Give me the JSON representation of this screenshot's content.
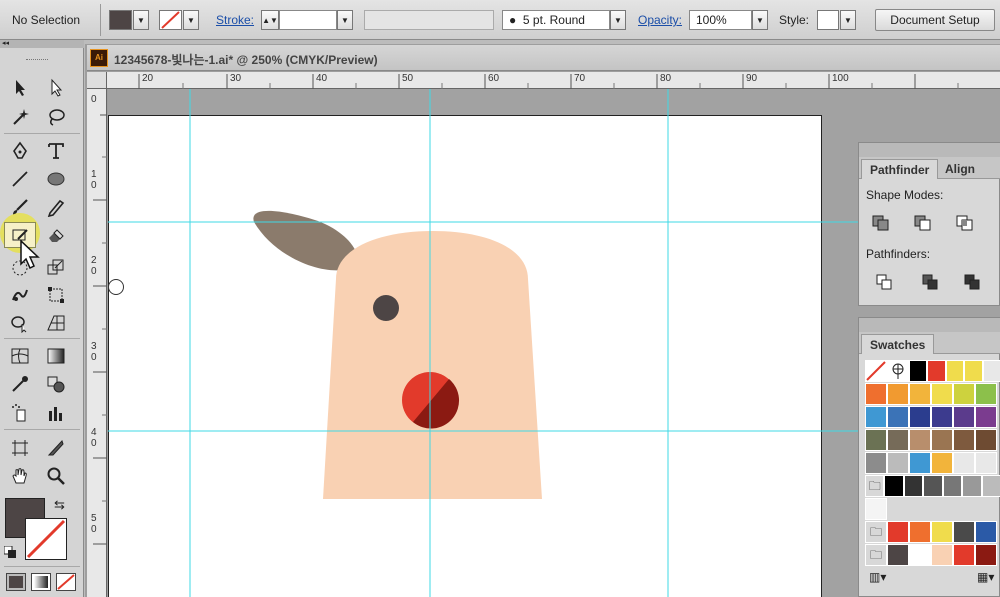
{
  "control_bar": {
    "selection": "No Selection",
    "fill_color": "#4d4545",
    "stroke_label": "Stroke:",
    "brush": "5 pt. Round",
    "opacity_label": "Opacity:",
    "opacity_value": "100%",
    "style_label": "Style:",
    "document_setup": "Document Setup"
  },
  "document": {
    "title": "12345678-빛나는-1.ai* @ 250% (CMYK/Preview)",
    "icon_label": "Ai"
  },
  "rulers": {
    "h": [
      "20",
      "30",
      "40",
      "50",
      "60",
      "70",
      "80",
      "90",
      "100"
    ],
    "v": [
      "0",
      "1 0",
      "2 0",
      "3 0",
      "4 0",
      "5 0"
    ]
  },
  "pathfinder": {
    "tab_active": "Pathfinder",
    "tab_other": "Align",
    "shape_modes": "Shape Modes:",
    "pathfinders": "Pathfinders:"
  },
  "swatches": {
    "title": "Swatches",
    "rows": [
      [
        "#ffffff",
        "#ffffff",
        "#000000",
        "#e23a2b",
        "#f0dc4c",
        "#f0dc4c",
        "#e8e8e8"
      ],
      [
        "#ef6f2e",
        "#f19a30",
        "#f2b43b",
        "#f0dc4c",
        "#cdd23e",
        "#8cc04b"
      ],
      [
        "#3f98d3",
        "#3b73b7",
        "#2b3d8e",
        "#3c3b8e",
        "#5b3b8c",
        "#7b3c8f"
      ],
      [
        "#6b7254",
        "#766b59",
        "#b88e6c",
        "#9a7552",
        "#7e5a3e",
        "#6e4b32"
      ],
      [
        "#8c8c8c",
        "#bbbbbb",
        "#3f98d3",
        "#f2b43b",
        "#e8e8e8",
        "#e8e8e8"
      ],
      [
        "#000000",
        "#333333",
        "#555555",
        "#777777",
        "#999999",
        "#bbbbbb"
      ],
      [
        "#f4f4f4"
      ],
      [
        "#e23a2b",
        "#ef6f2e",
        "#f0dc4c",
        "#4a4a4a",
        "#2b5aa7"
      ],
      [
        "#4d4545",
        "#ffffff",
        "#f9d1b3",
        "#e23a2b",
        "#8b1a12"
      ]
    ]
  },
  "colors": {
    "skin": "#f9d1b3",
    "ear": "#8b7b6c",
    "eye": "#4d4545",
    "nose": "#e23a2b",
    "nose_dark": "#8b1a12",
    "guide": "#3fd9e6"
  }
}
